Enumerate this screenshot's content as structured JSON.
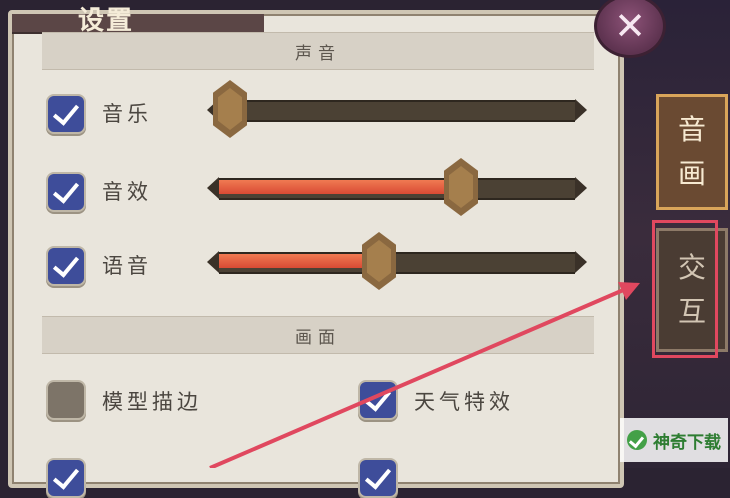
{
  "panel": {
    "title": "设置"
  },
  "sections": {
    "sound": "声音",
    "graphics": "画面"
  },
  "sound": {
    "items": [
      {
        "label": "音乐",
        "checked": true,
        "level": 0.03
      },
      {
        "label": "音效",
        "checked": true,
        "level": 0.68
      },
      {
        "label": "语音",
        "checked": true,
        "level": 0.45
      }
    ]
  },
  "graphics": {
    "model_outline": {
      "label": "模型描边",
      "checked": false
    },
    "weather_effects": {
      "label": "天气特效",
      "checked": true
    }
  },
  "tabs": [
    {
      "label_top": "音",
      "label_bottom": "画",
      "active": true
    },
    {
      "label_top": "交",
      "label_bottom": "互",
      "active": false
    }
  ],
  "close_icon": "close-icon",
  "watermark": {
    "text": "神奇下载"
  },
  "colors": {
    "checkbox_on": "#3e4d9a",
    "slider_fill": "#e05a3c",
    "highlight": "#e0485f"
  }
}
